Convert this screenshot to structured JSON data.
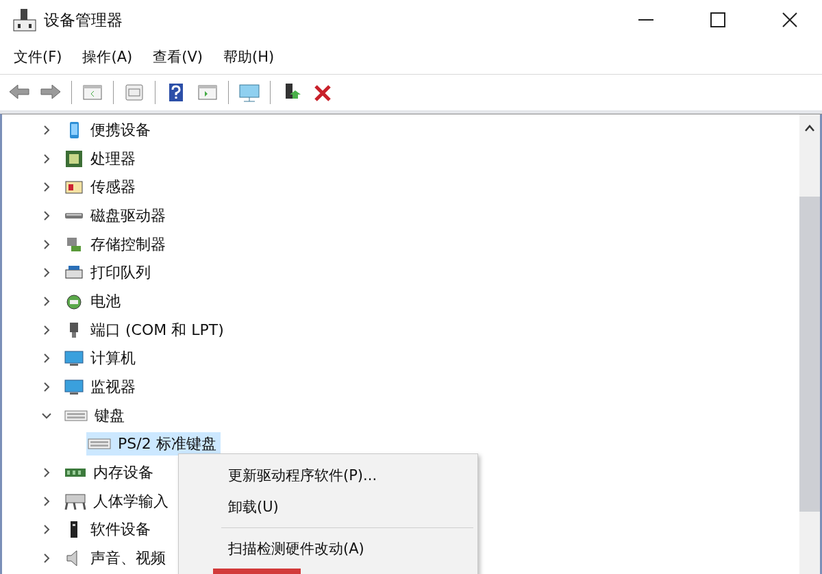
{
  "window": {
    "title": "设备管理器"
  },
  "menu": [
    "文件(F)",
    "操作(A)",
    "查看(V)",
    "帮助(H)"
  ],
  "tree": [
    {
      "label": "便携设备",
      "expanded": false
    },
    {
      "label": "处理器",
      "expanded": false
    },
    {
      "label": "传感器",
      "expanded": false
    },
    {
      "label": "磁盘驱动器",
      "expanded": false
    },
    {
      "label": "存储控制器",
      "expanded": false
    },
    {
      "label": "打印队列",
      "expanded": false
    },
    {
      "label": "电池",
      "expanded": false
    },
    {
      "label": "端口 (COM 和 LPT)",
      "expanded": false
    },
    {
      "label": "计算机",
      "expanded": false
    },
    {
      "label": "监视器",
      "expanded": false
    },
    {
      "label": "键盘",
      "expanded": true,
      "children": [
        {
          "label": "PS/2 标准键盘",
          "selected": true
        }
      ]
    },
    {
      "label": "内存设备",
      "expanded": false
    },
    {
      "label": "人体学输入",
      "expanded": false
    },
    {
      "label": "软件设备",
      "expanded": false
    },
    {
      "label": "声音、视频",
      "expanded": false
    }
  ],
  "context_menu": [
    {
      "kind": "item",
      "label": "更新驱动程序软件(P)..."
    },
    {
      "kind": "item",
      "label": "卸载(U)"
    },
    {
      "kind": "separator"
    },
    {
      "kind": "item",
      "label": "扫描检测硬件改动(A)"
    },
    {
      "kind": "highlight"
    }
  ]
}
